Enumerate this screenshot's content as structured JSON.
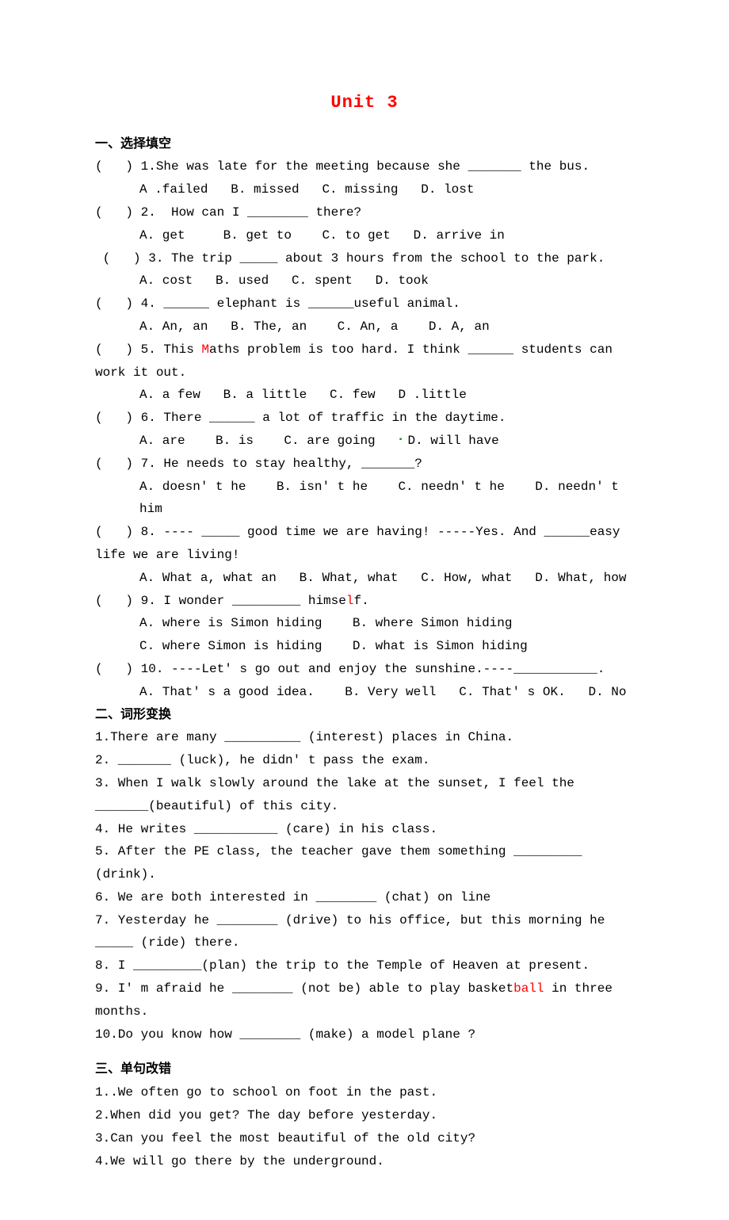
{
  "title": "Unit 3",
  "section1": {
    "header": "一、选择填空",
    "items": [
      {
        "q": "(   ) 1.She was late for the meeting because she _______ the bus.",
        "opts": "A .failed   B. missed   C. missing   D. lost"
      },
      {
        "q": "(   ) 2.  How can I ________ there?",
        "opts": "A. get     B. get to    C. to get   D. arrive in"
      },
      {
        "q": " (   ) 3. The trip _____ about 3 hours from the school to the park.",
        "opts": "A. cost   B. used   C. spent   D. took"
      },
      {
        "q": "(   ) 4. ______ elephant is ______useful animal.",
        "opts": "A. An, an   B. The, an    C. An, a    D. A, an"
      },
      {
        "q_pre": "(   ) 5. This ",
        "q_red": "M",
        "q_post": "aths problem is too hard. I think ______ students can work it out.",
        "opts": "A. a few   B. a little   C. few   D .little"
      },
      {
        "q": "(   ) 6. There ______ a lot of traffic in the daytime.",
        "opts_pre": "A. are    B. is    C. are going   ",
        "opts_post": "D. will have",
        "green": "▪ "
      },
      {
        "q": "(   ) 7. He needs to stay healthy, _______?",
        "opts": "A. doesn' t he    B. isn' t he    C. needn' t he    D. needn' t him"
      },
      {
        "q": "(   ) 8. ---- _____ good time we are having! -----Yes. And ______easy life we are living!",
        "opts": "A. What a, what an   B. What, what   C. How, what   D. What, how"
      },
      {
        "q_pre": "(   ) 9. I wonder _________ himse",
        "q_red": "l",
        "q_post": "f.",
        "opts1": "A. where is Simon hiding    B. where Simon hiding",
        "opts2": "C. where Simon is hiding    D. what is Simon hiding"
      },
      {
        "q": "(   ) 10. ----Let' s go out and enjoy the sunshine.----___________.",
        "opts": "A. That' s a good idea.    B. Very well   C. That' s OK.   D. No"
      }
    ]
  },
  "section2": {
    "header": "二、词形变换",
    "items": [
      "1.There are many __________ (interest) places in China.",
      "2. _______ (luck), he didn' t pass the exam.",
      "3. When I walk slowly around the lake at the sunset, I feel the _______(beautiful) of this city.",
      "4. He writes ___________ (care) in his class.",
      "5. After the PE class, the teacher gave them something _________ (drink).",
      "6. We are both interested in ________ (chat) on line",
      "7. Yesterday he ________ (drive) to his office, but this morning he _____ (ride) there.",
      "8. I _________(plan) the trip to the Temple of Heaven at present."
    ],
    "item9_pre": "9. I' m afraid he ________ (not be) able to play basket",
    "item9_red": "ball",
    "item9_post": " in three months.",
    "item10": "10.Do you know how ________ (make) a model plane ?"
  },
  "section3": {
    "header": "三、单句改错",
    "items": [
      "1..We often go to school on foot in the past.",
      "2.When did you get? The day before yesterday.",
      "3.Can you feel the most beautiful of the old city?",
      "4.We will go there by the underground."
    ]
  }
}
